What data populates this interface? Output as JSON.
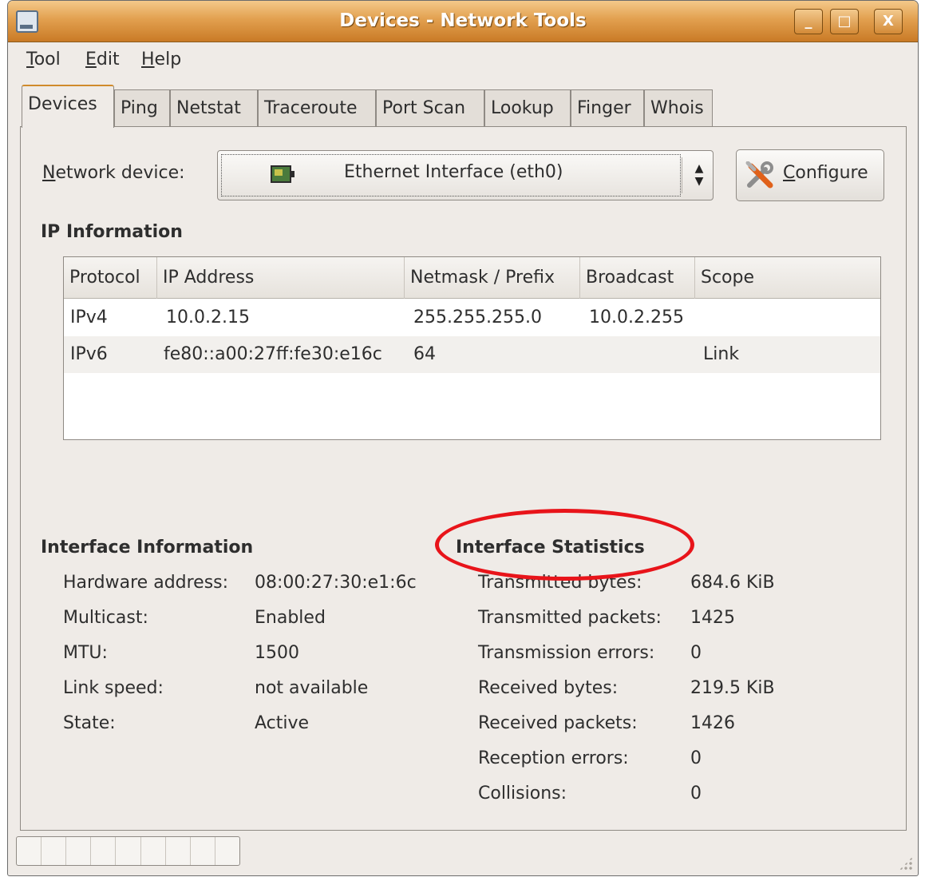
{
  "window": {
    "title": "Devices - Network Tools"
  },
  "titlebar_buttons": {
    "minimize": "_",
    "maximize": "□",
    "close": "X"
  },
  "menubar": [
    {
      "mnemonic": "T",
      "rest": "ool"
    },
    {
      "mnemonic": "E",
      "rest": "dit"
    },
    {
      "mnemonic": "H",
      "rest": "elp"
    }
  ],
  "tabs": [
    "Devices",
    "Ping",
    "Netstat",
    "Traceroute",
    "Port Scan",
    "Lookup",
    "Finger",
    "Whois"
  ],
  "active_tab": "Devices",
  "device_selector": {
    "label_mnemonic": "N",
    "label_rest": "etwork device:",
    "value": "Ethernet Interface (eth0)",
    "arrows": "▲▼"
  },
  "configure_button": {
    "mnemonic": "C",
    "rest": "onfigure"
  },
  "ip_information": {
    "heading": "IP Information",
    "columns": [
      "Protocol",
      "IP Address",
      "Netmask / Prefix",
      "Broadcast",
      "Scope"
    ],
    "rows": [
      {
        "protocol": "IPv4",
        "address": "10.0.2.15",
        "netmask": "255.255.255.0",
        "broadcast": "10.0.2.255",
        "scope": ""
      },
      {
        "protocol": "IPv6",
        "address": "fe80::a00:27ff:fe30:e16c",
        "netmask": "64",
        "broadcast": "",
        "scope": "Link"
      }
    ]
  },
  "interface_information": {
    "heading": "Interface Information",
    "rows": [
      {
        "label": "Hardware address:",
        "value": "08:00:27:30:e1:6c"
      },
      {
        "label": "Multicast:",
        "value": "Enabled"
      },
      {
        "label": "MTU:",
        "value": "1500"
      },
      {
        "label": "Link speed:",
        "value": "not available"
      },
      {
        "label": "State:",
        "value": "Active"
      }
    ]
  },
  "interface_statistics": {
    "heading": "Interface Statistics",
    "rows": [
      {
        "label": "Transmitted bytes:",
        "value": "684.6 KiB"
      },
      {
        "label": "Transmitted packets:",
        "value": "1425"
      },
      {
        "label": "Transmission errors:",
        "value": "0"
      },
      {
        "label": "Received bytes:",
        "value": "219.5 KiB"
      },
      {
        "label": "Received packets:",
        "value": "1426"
      },
      {
        "label": "Reception errors:",
        "value": "0"
      },
      {
        "label": "Collisions:",
        "value": "0"
      }
    ]
  },
  "colors": {
    "titlebar": "#d38a37",
    "highlight_ellipse": "#e8141a",
    "window_bg": "#efebe7"
  }
}
